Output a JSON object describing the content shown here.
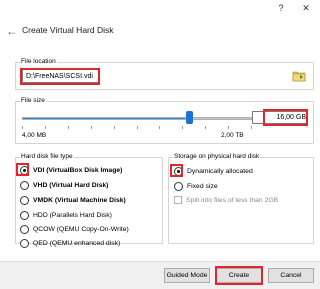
{
  "window": {
    "help_icon": "?",
    "close_icon": "✕"
  },
  "header": {
    "back_icon": "arrow-left-icon",
    "title": "Create Virtual Hard Disk"
  },
  "file_location": {
    "label": "File location",
    "value": "D:\\FreeNAS\\SCSI.vdi",
    "folder_icon": "folder-icon"
  },
  "file_size": {
    "label": "File size",
    "min_label": "4,00 MB",
    "max_label": "2,00 TB",
    "value": "16,00 GB",
    "slider_fraction": 0.71
  },
  "disk_type": {
    "label": "Hard disk file type",
    "options": [
      {
        "label": "VDI (VirtualBox Disk Image)",
        "checked": true,
        "bold": true
      },
      {
        "label": "VHD (Virtual Hard Disk)",
        "checked": false,
        "bold": true
      },
      {
        "label": "VMDK (Virtual Machine Disk)",
        "checked": false,
        "bold": true
      },
      {
        "label": "HDD (Parallels Hard Disk)",
        "checked": false,
        "bold": false
      },
      {
        "label": "QCOW (QEMU Copy-On-Write)",
        "checked": false,
        "bold": false
      },
      {
        "label": "QED (QEMU enhanced disk)",
        "checked": false,
        "bold": false
      }
    ]
  },
  "storage": {
    "label": "Storage on physical hard disk",
    "options": [
      {
        "label": "Dynamically allocated",
        "checked": true
      },
      {
        "label": "Fixed size",
        "checked": false
      }
    ],
    "split_label": "Split into files of less than 2GB",
    "split_checked": false
  },
  "buttons": {
    "guided_mode": "Guided Mode",
    "create": "Create",
    "cancel": "Cancel"
  },
  "colors": {
    "highlight": "#e0262b",
    "accent": "#1e88e5"
  }
}
